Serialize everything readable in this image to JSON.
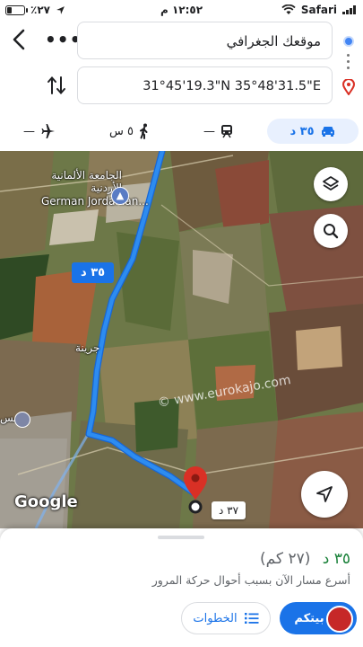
{
  "status_bar": {
    "battery": "٪٢٧",
    "time": "١٢:٥٢ م",
    "carrier": "Safari",
    "battery_level": 0.27
  },
  "search": {
    "origin_value": "موقعك الجغرافي",
    "destination_value": "31°45'19.3\"N 35°48'31.5\"E"
  },
  "modes": {
    "car_label": "٣٥ د",
    "transit_label": "—",
    "walk_label": "٥ س",
    "plane_label": "—"
  },
  "map": {
    "route_duration_badge": "٣٥ د",
    "alt_duration_badge": "٣٧ د",
    "label_university_ar": "الجامعة الألمانية الأردنية",
    "label_university_en": "German Jordanian...",
    "label_town": "جرينة",
    "label_left": "مس",
    "watermark": "© www.eurokajo.com",
    "google_logo": "Google",
    "route_color": "#2d8cf0"
  },
  "sheet": {
    "time": "٣٥ د",
    "distance": "(٢٧ كم)",
    "description": "أسرع مسار الآن بسبب أحوال حركة المرور",
    "steps_label": "الخطوات",
    "start_label": "بيتكم"
  },
  "icons": {
    "back": "chevron-left-icon",
    "more": "more-horiz-icon",
    "swap": "swap-vertical-icon",
    "origin": "location-dot-icon",
    "destination": "pin-icon",
    "car": "car-icon",
    "transit": "train-icon",
    "walk": "walk-icon",
    "plane": "plane-icon",
    "layers": "layers-icon",
    "search": "search-icon",
    "navigate": "navigation-arrow-icon",
    "steps": "list-icon"
  }
}
